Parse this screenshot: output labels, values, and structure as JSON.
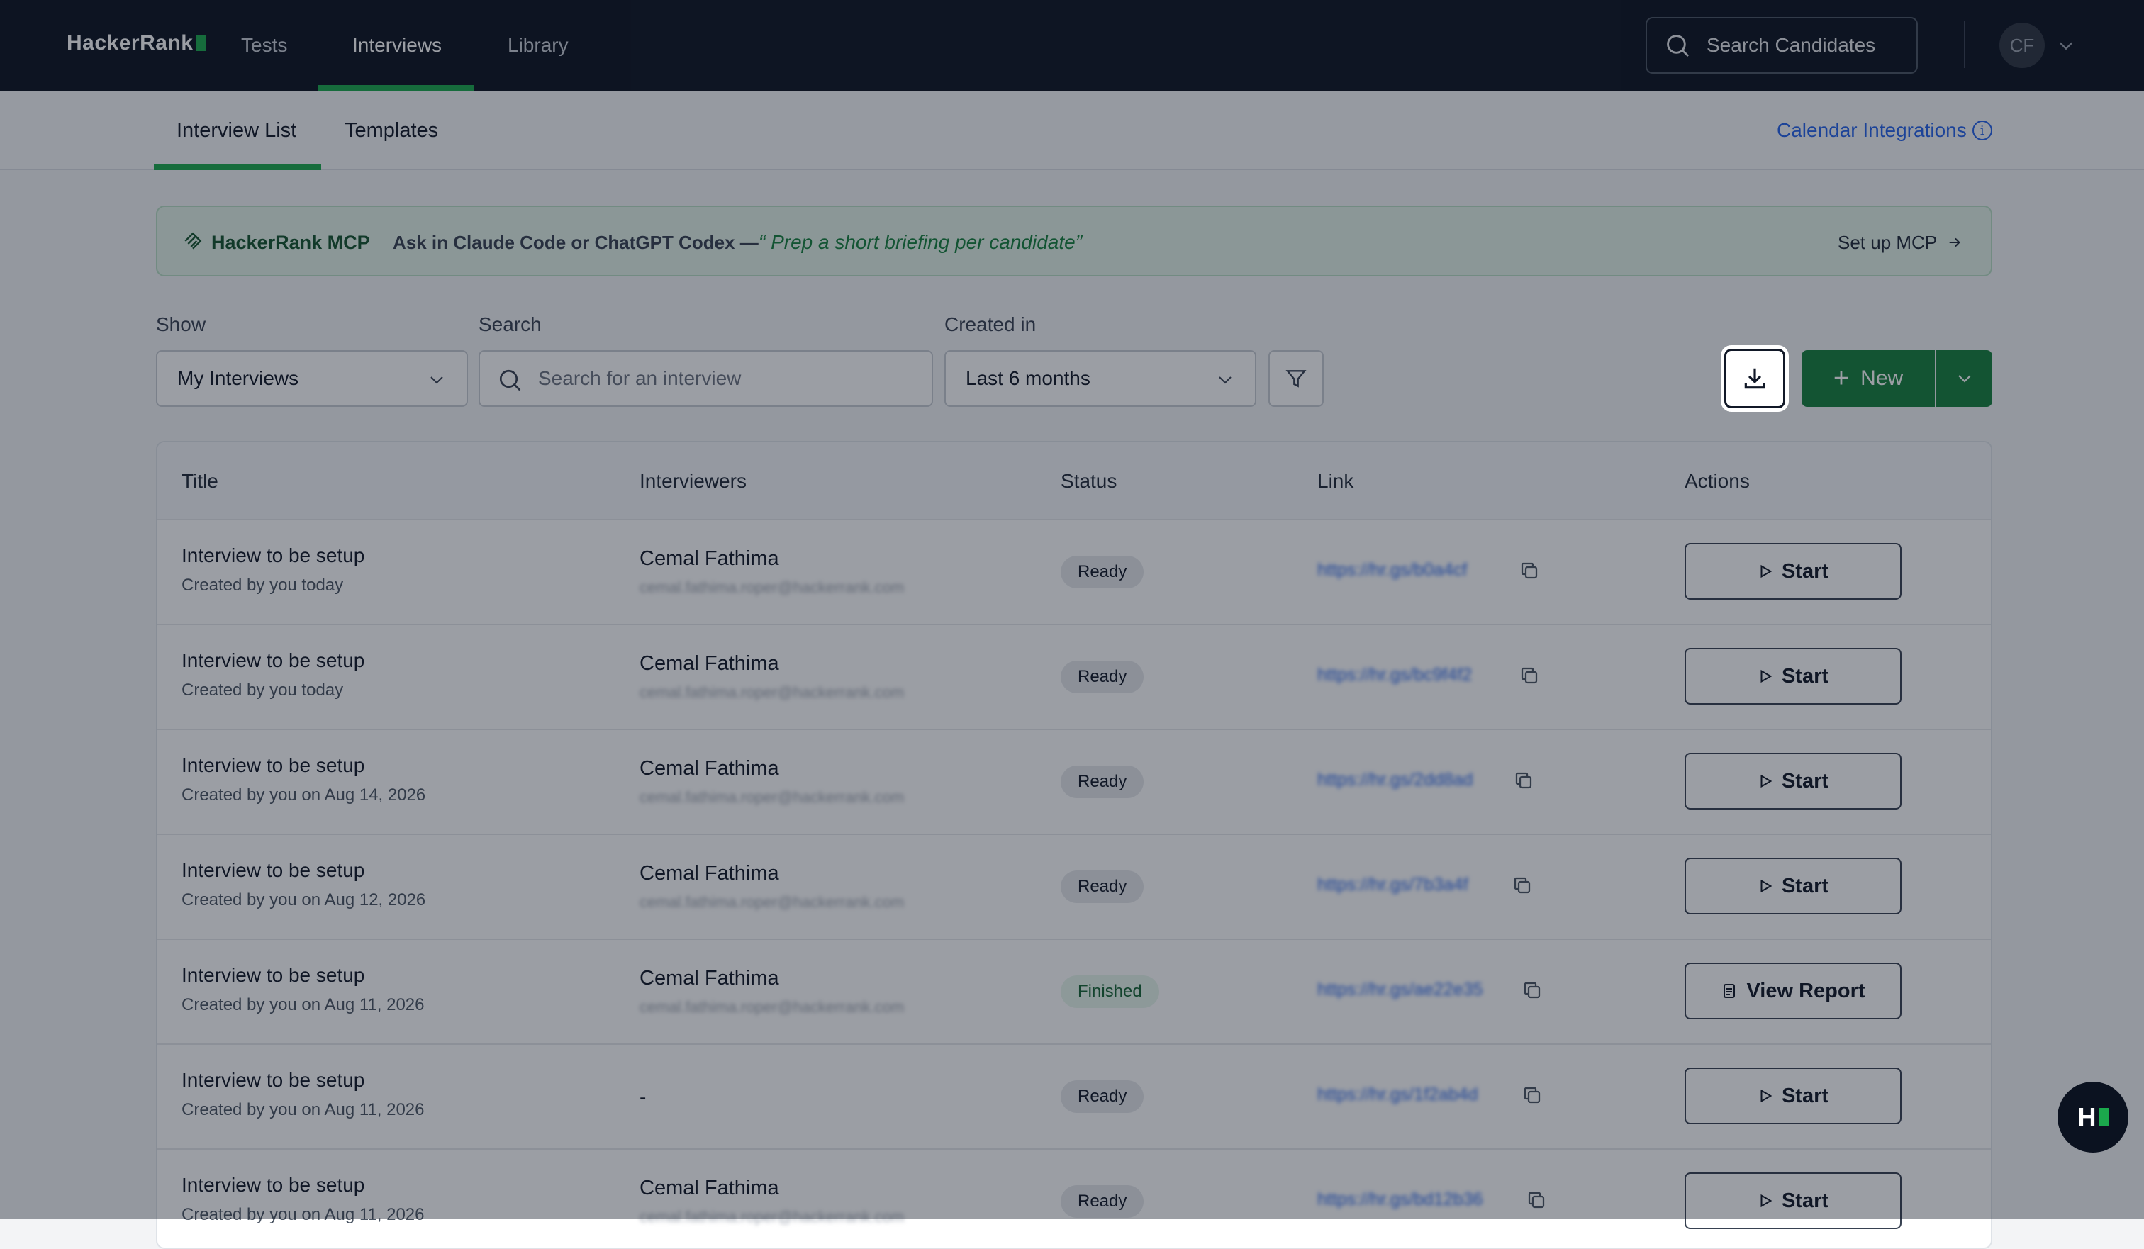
{
  "nav": {
    "logo": "HackerRank",
    "links": [
      {
        "label": "Tests",
        "active": false
      },
      {
        "label": "Interviews",
        "active": true
      },
      {
        "label": "Library",
        "active": false
      }
    ],
    "search_label": "Search Candidates",
    "avatar_initials": "CF"
  },
  "subnav": {
    "tabs": [
      {
        "label": "Interview List",
        "active": true
      },
      {
        "label": "Templates",
        "active": false
      }
    ],
    "calendar_integrations": "Calendar Integrations"
  },
  "banner": {
    "title": "HackerRank MCP",
    "ask": "Ask in Claude Code or ChatGPT Codex —",
    "quote": "“ Prep a short briefing per candidate”",
    "cta": "Set up MCP"
  },
  "filters": {
    "show_label": "Show",
    "show_value": "My Interviews",
    "search_label": "Search",
    "search_placeholder": "Search for an interview",
    "created_label": "Created in",
    "created_value": "Last 6 months"
  },
  "actions": {
    "new_label": "New"
  },
  "table": {
    "headers": [
      "Title",
      "Interviewers",
      "Status",
      "Link",
      "Actions"
    ],
    "rows": [
      {
        "title": "Interview to be setup",
        "sub": "Created by you today",
        "interviewer": "Cemal Fathima",
        "email": "cemal.fathima.roper@hackerrank.com",
        "status": "Ready",
        "link": "https://hr.gs/b0a4cf",
        "action": "Start"
      },
      {
        "title": "Interview to be setup",
        "sub": "Created by you today",
        "interviewer": "Cemal Fathima",
        "email": "cemal.fathima.roper@hackerrank.com",
        "status": "Ready",
        "link": "https://hr.gs/bc9f4f2",
        "action": "Start"
      },
      {
        "title": "Interview to be setup",
        "sub": "Created by you on Aug 14, 2026",
        "interviewer": "Cemal Fathima",
        "email": "cemal.fathima.roper@hackerrank.com",
        "status": "Ready",
        "link": "https://hr.gs/2dd8ad",
        "action": "Start"
      },
      {
        "title": "Interview to be setup",
        "sub": "Created by you on Aug 12, 2026",
        "interviewer": "Cemal Fathima",
        "email": "cemal.fathima.roper@hackerrank.com",
        "status": "Ready",
        "link": "https://hr.gs/7b3a4f",
        "action": "Start"
      },
      {
        "title": "Interview to be setup",
        "sub": "Created by you on Aug 11, 2026",
        "interviewer": "Cemal Fathima",
        "email": "cemal.fathima.roper@hackerrank.com",
        "status": "Finished",
        "link": "https://hr.gs/ae22e35",
        "action": "View Report"
      },
      {
        "title": "Interview to be setup",
        "sub": "Created by you on Aug 11, 2026",
        "interviewer": "-",
        "email": "",
        "status": "Ready",
        "link": "https://hr.gs/1f2ab4d",
        "action": "Start"
      },
      {
        "title": "Interview to be setup",
        "sub": "Created by you on Aug 11, 2026",
        "interviewer": "Cemal Fathima",
        "email": "cemal.fathima.roper@hackerrank.com",
        "status": "Ready",
        "link": "https://hr.gs/bd12b36",
        "action": "Start"
      }
    ]
  },
  "fab_label": "H",
  "colors": {
    "brand_green": "#1ba94c",
    "button_green": "#15803d",
    "nav_bg": "#0b1220",
    "link_blue": "#2563eb"
  }
}
